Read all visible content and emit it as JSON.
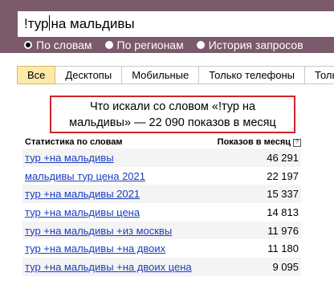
{
  "search": {
    "query_before_caret": "!тур",
    "query_after_caret": "на мальдивы"
  },
  "mode_options": [
    {
      "label": "По словам",
      "checked": true
    },
    {
      "label": "По регионам",
      "checked": false
    },
    {
      "label": "История запросов",
      "checked": false
    }
  ],
  "device_tabs": [
    "Все",
    "Десктопы",
    "Мобильные",
    "Только телефоны",
    "Только планшеты"
  ],
  "active_tab": "Все",
  "summary": {
    "line1": "Что искали со словом «!тур на",
    "line2": "мальдивы» — 22 090 показов в месяц"
  },
  "stats_table": {
    "header_left": "Статистика по словам",
    "header_right": "Показов в месяц",
    "help_glyph": "?",
    "rows": [
      {
        "keyword": "тур +на мальдивы",
        "count": "46 291"
      },
      {
        "keyword": "мальдивы тур цена 2021",
        "count": "22 197"
      },
      {
        "keyword": "тур +на мальдивы 2021",
        "count": "15 337"
      },
      {
        "keyword": "тур +на мальдивы цена",
        "count": "14 813"
      },
      {
        "keyword": "тур +на мальдивы +из москвы",
        "count": "11 976"
      },
      {
        "keyword": "тур +на мальдивы +на двоих",
        "count": "11 180"
      },
      {
        "keyword": "тур +на мальдивы +на двоих цена",
        "count": "9 095"
      }
    ]
  },
  "colors": {
    "header_bg": "#7a5a6b",
    "active_tab_bg": "#ffe9a8",
    "highlight_border": "#d0232a",
    "link": "#1a3dc1"
  }
}
